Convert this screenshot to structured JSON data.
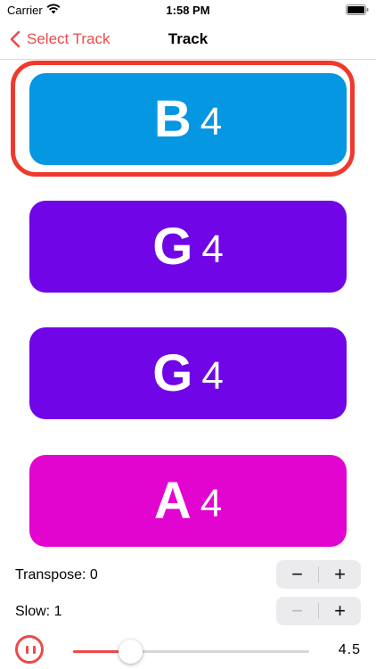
{
  "status_bar": {
    "carrier": "Carrier",
    "time": "1:58 PM"
  },
  "nav": {
    "back_label": "Select Track",
    "title": "Track"
  },
  "notes": [
    {
      "letter": "B",
      "octave": "4",
      "color": "#0597e2",
      "selected": true
    },
    {
      "letter": "G",
      "octave": "4",
      "color": "#7006e7",
      "selected": false
    },
    {
      "letter": "G",
      "octave": "4",
      "color": "#7006e7",
      "selected": false
    },
    {
      "letter": "A",
      "octave": "4",
      "color": "#e205d0",
      "selected": false
    }
  ],
  "colors": {
    "accent": "#ee4a4a",
    "highlight": "#f0392d"
  },
  "transpose": {
    "label": "Transpose: 0",
    "minus": "−",
    "plus": "+"
  },
  "slow": {
    "label": "Slow: 1",
    "minus": "−",
    "plus": "+"
  },
  "playback": {
    "state": "playing",
    "slider_fraction": 0.24,
    "value": "4.5"
  }
}
